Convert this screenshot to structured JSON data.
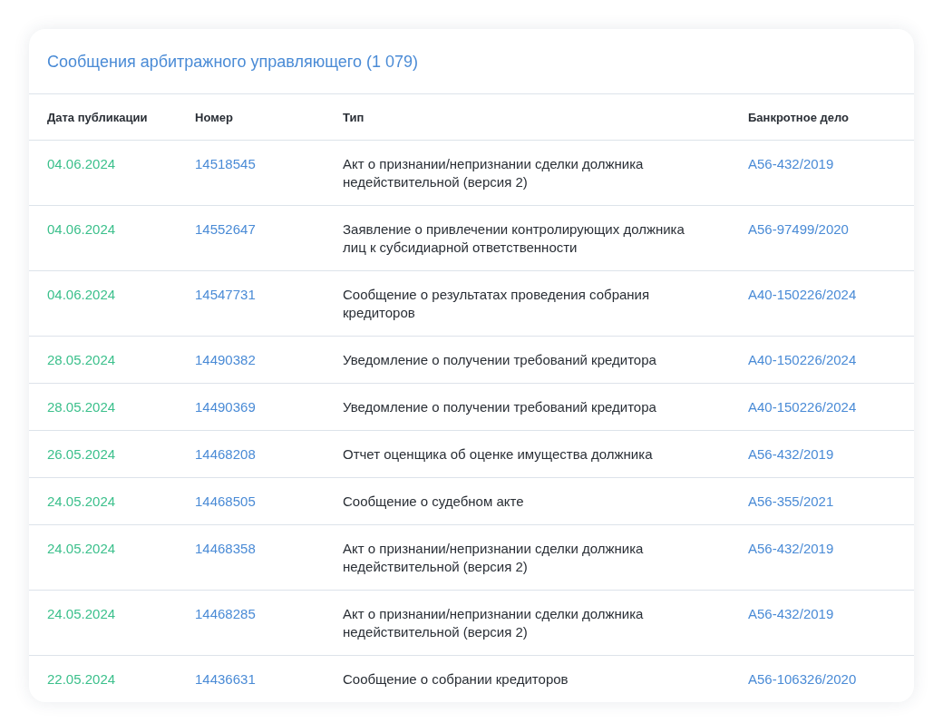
{
  "title": "Сообщения арбитражного управляющего (1 079)",
  "table": {
    "columns": [
      "Дата публикации",
      "Номер",
      "Тип",
      "Банкротное дело"
    ],
    "rows": [
      {
        "date": "04.06.2024",
        "number": "14518545",
        "type": "Акт о признании/непризнании сделки должника недействительной (версия 2)",
        "case": "А56-432/2019"
      },
      {
        "date": "04.06.2024",
        "number": "14552647",
        "type": "Заявление о привлечении контролирующих должника лиц к субсидиарной ответственности",
        "case": "А56-97499/2020"
      },
      {
        "date": "04.06.2024",
        "number": "14547731",
        "type": "Сообщение о результатах проведения собрания кредиторов",
        "case": "А40-150226/2024"
      },
      {
        "date": "28.05.2024",
        "number": "14490382",
        "type": "Уведомление о получении требований кредитора",
        "case": "А40-150226/2024"
      },
      {
        "date": "28.05.2024",
        "number": "14490369",
        "type": "Уведомление о получении требований кредитора",
        "case": "А40-150226/2024"
      },
      {
        "date": "26.05.2024",
        "number": "14468208",
        "type": "Отчет оценщика об оценке имущества должника",
        "case": "А56-432/2019"
      },
      {
        "date": "24.05.2024",
        "number": "14468505",
        "type": "Сообщение о судебном акте",
        "case": "А56-355/2021"
      },
      {
        "date": "24.05.2024",
        "number": "14468358",
        "type": "Акт о признании/непризнании сделки должника недействительной (версия 2)",
        "case": "А56-432/2019"
      },
      {
        "date": "24.05.2024",
        "number": "14468285",
        "type": "Акт о признании/непризнании сделки должника недействительной (версия 2)",
        "case": "А56-432/2019"
      },
      {
        "date": "22.05.2024",
        "number": "14436631",
        "type": "Сообщение о собрании кредиторов",
        "case": "А56-106326/2020"
      }
    ]
  }
}
